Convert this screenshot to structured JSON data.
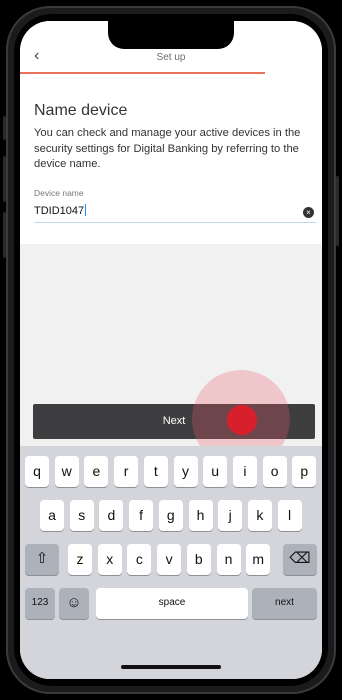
{
  "header": {
    "back_icon": "chevron-left-icon",
    "back_glyph": "‹",
    "title": "Set up"
  },
  "progress": {
    "fraction": 0.81,
    "color": "#e8735a"
  },
  "main": {
    "heading": "Name device",
    "description": "You can check and manage your active devices in the security settings for Digital Banking by referring to the device name.",
    "field": {
      "label": "Device name",
      "value": "TDID1047",
      "clear_icon": "clear-icon",
      "clear_glyph": "×"
    }
  },
  "next_button": {
    "label": "Next"
  },
  "keyboard": {
    "row1": [
      "q",
      "w",
      "e",
      "r",
      "t",
      "y",
      "u",
      "i",
      "o",
      "p"
    ],
    "row2": [
      "a",
      "s",
      "d",
      "f",
      "g",
      "h",
      "j",
      "k",
      "l"
    ],
    "row3": [
      "z",
      "x",
      "c",
      "v",
      "b",
      "n",
      "m"
    ],
    "shift_glyph": "⇧",
    "delete_glyph": "⌫",
    "numbers_label": "123",
    "emoji_glyph": "☺",
    "space_label": "space",
    "return_label": "next"
  }
}
